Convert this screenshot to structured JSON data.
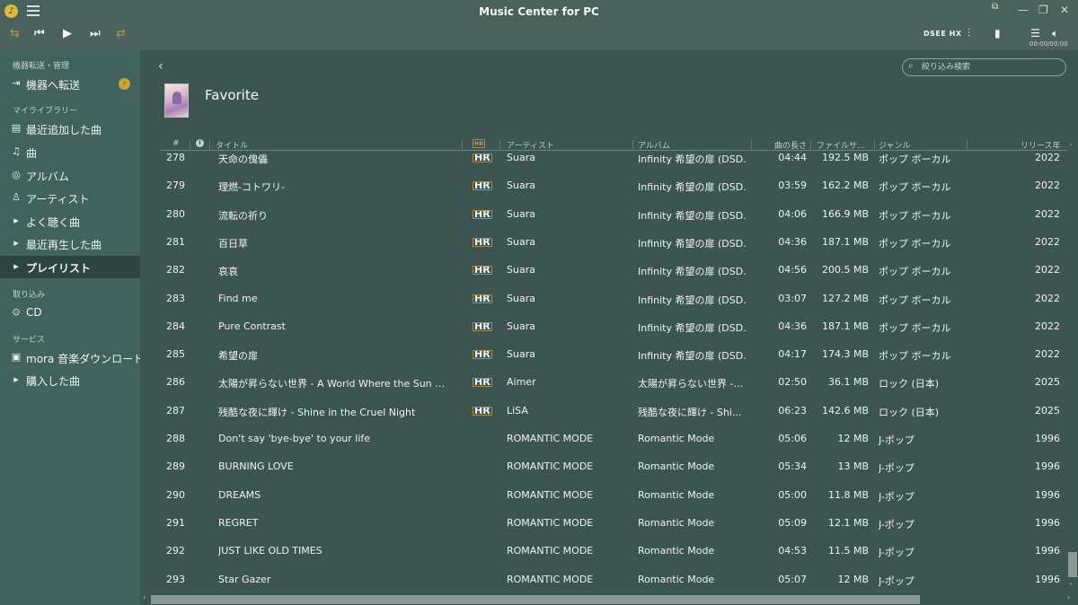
{
  "app": {
    "title": "Music Center for PC",
    "time_readout": "00:00/00:00",
    "dsee_label": "DSEE HX"
  },
  "sidebar": {
    "section_device": "機器転送・管理",
    "transfer_label": "機器へ転送",
    "section_library": "マイライブラリー",
    "library_items": [
      {
        "label": "最近追加した曲",
        "icon": "recent-added-icon"
      },
      {
        "label": "曲",
        "icon": "note-icon"
      },
      {
        "label": "アルバム",
        "icon": "album-icon"
      },
      {
        "label": "アーティスト",
        "icon": "artist-icon"
      },
      {
        "label": "よく聴く曲",
        "icon": "playlist-icon"
      },
      {
        "label": "最近再生した曲",
        "icon": "playlist-icon"
      },
      {
        "label": "プレイリスト",
        "icon": "playlist-icon"
      }
    ],
    "section_import": "取り込み",
    "import_cd": "CD",
    "section_service": "サービス",
    "service_items": [
      {
        "label": "mora 音楽ダウンロード"
      },
      {
        "label": "購入した曲"
      }
    ]
  },
  "main": {
    "search_placeholder": "絞り込み検索",
    "playlist_title": "Favorite",
    "columns": {
      "num": "#",
      "title": "タイトル",
      "hr": "HR",
      "artist": "アーティスト",
      "album": "アルバム",
      "length": "曲の長さ",
      "size": "ファイルサ...",
      "genre": "ジャンル",
      "release": "リリース年"
    },
    "rows": [
      {
        "num": "278",
        "title": "天命の傀儡",
        "hr": "HR",
        "artist": "Suara",
        "album": "Infinity 希望の扉 (DSD...",
        "length": "04:44",
        "size": "192.5 MB",
        "genre": "ポップ ボーカル",
        "year": "2022"
      },
      {
        "num": "279",
        "title": "理燃-コトワリ-",
        "hr": "HR",
        "artist": "Suara",
        "album": "Infinity 希望の扉 (DSD...",
        "length": "03:59",
        "size": "162.2 MB",
        "genre": "ポップ ボーカル",
        "year": "2022"
      },
      {
        "num": "280",
        "title": "流転の祈り",
        "hr": "HR",
        "artist": "Suara",
        "album": "Infinity 希望の扉 (DSD...",
        "length": "04:06",
        "size": "166.9 MB",
        "genre": "ポップ ボーカル",
        "year": "2022"
      },
      {
        "num": "281",
        "title": "百日草",
        "hr": "HR",
        "artist": "Suara",
        "album": "Infinity 希望の扉 (DSD...",
        "length": "04:36",
        "size": "187.1 MB",
        "genre": "ポップ ボーカル",
        "year": "2022"
      },
      {
        "num": "282",
        "title": "哀哀",
        "hr": "HR",
        "artist": "Suara",
        "album": "Infinity 希望の扉 (DSD...",
        "length": "04:56",
        "size": "200.5 MB",
        "genre": "ポップ ボーカル",
        "year": "2022"
      },
      {
        "num": "283",
        "title": "Find me",
        "hr": "HR",
        "artist": "Suara",
        "album": "Infinity 希望の扉 (DSD...",
        "length": "03:07",
        "size": "127.2 MB",
        "genre": "ポップ ボーカル",
        "year": "2022"
      },
      {
        "num": "284",
        "title": "Pure Contrast",
        "hr": "HR",
        "artist": "Suara",
        "album": "Infinity 希望の扉 (DSD...",
        "length": "04:36",
        "size": "187.1 MB",
        "genre": "ポップ ボーカル",
        "year": "2022"
      },
      {
        "num": "285",
        "title": "希望の扉",
        "hr": "HR",
        "artist": "Suara",
        "album": "Infinity 希望の扉 (DSD...",
        "length": "04:17",
        "size": "174.3 MB",
        "genre": "ポップ ボーカル",
        "year": "2022"
      },
      {
        "num": "286",
        "title": "太陽が昇らない世界 - A World Where the Sun Ne...",
        "hr": "HR",
        "artist": "Aimer",
        "album": "太陽が昇らない世界 -...",
        "length": "02:50",
        "size": "36.1 MB",
        "genre": "ロック (日本)",
        "year": "2025"
      },
      {
        "num": "287",
        "title": "残酷な夜に輝け - Shine in the Cruel Night",
        "hr": "HR",
        "artist": "LiSA",
        "album": "残酷な夜に輝け - Shi...",
        "length": "06:23",
        "size": "142.6 MB",
        "genre": "ロック (日本)",
        "year": "2025"
      },
      {
        "num": "288",
        "title": "Don't say 'bye-bye' to your life",
        "hr": "",
        "artist": "ROMANTIC MODE",
        "album": "Romantic Mode",
        "length": "05:06",
        "size": "12 MB",
        "genre": "J-ポップ",
        "year": "1996"
      },
      {
        "num": "289",
        "title": "BURNING LOVE",
        "hr": "",
        "artist": "ROMANTIC MODE",
        "album": "Romantic Mode",
        "length": "05:34",
        "size": "13 MB",
        "genre": "J-ポップ",
        "year": "1996"
      },
      {
        "num": "290",
        "title": "DREAMS",
        "hr": "",
        "artist": "ROMANTIC MODE",
        "album": "Romantic Mode",
        "length": "05:00",
        "size": "11.8 MB",
        "genre": "J-ポップ",
        "year": "1996"
      },
      {
        "num": "291",
        "title": "REGRET",
        "hr": "",
        "artist": "ROMANTIC MODE",
        "album": "Romantic Mode",
        "length": "05:09",
        "size": "12.1 MB",
        "genre": "J-ポップ",
        "year": "1996"
      },
      {
        "num": "292",
        "title": "JUST LIKE OLD TIMES",
        "hr": "",
        "artist": "ROMANTIC MODE",
        "album": "Romantic Mode",
        "length": "04:53",
        "size": "11.5 MB",
        "genre": "J-ポップ",
        "year": "1996"
      },
      {
        "num": "293",
        "title": "Star Gazer",
        "hr": "",
        "artist": "ROMANTIC MODE",
        "album": "Romantic Mode",
        "length": "05:07",
        "size": "12 MB",
        "genre": "J-ポップ",
        "year": "1996"
      }
    ]
  }
}
